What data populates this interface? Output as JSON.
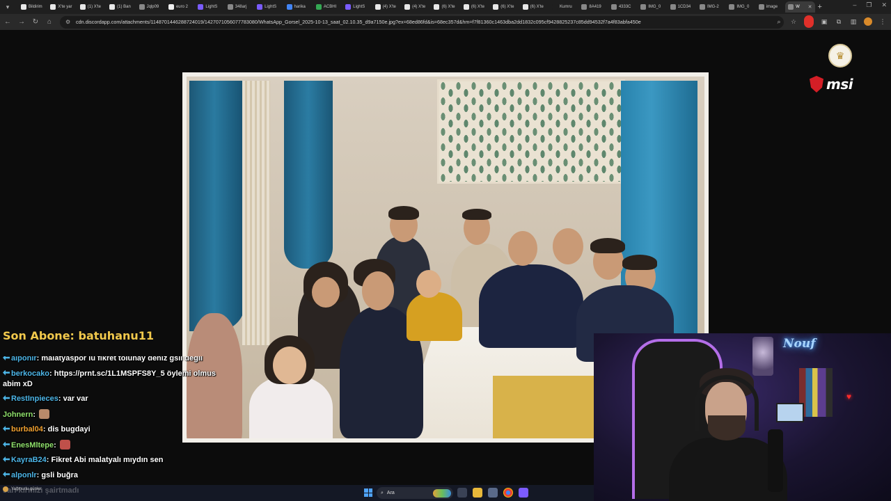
{
  "browser": {
    "tabs": [
      {
        "label": "Bildirim",
        "fav": "#e8e8e8"
      },
      {
        "label": "X'te yar",
        "fav": "#e8e8e8"
      },
      {
        "label": "(1) X'te",
        "fav": "#e8e8e8"
      },
      {
        "label": "(1) Ban",
        "fav": "#e8e8e8"
      },
      {
        "label": "Jqlp09",
        "fav": "#888888"
      },
      {
        "label": "euro 2",
        "fav": "#f0f0f0"
      },
      {
        "label": "LightS",
        "fav": "#7a5cff"
      },
      {
        "label": "348arj",
        "fav": "#888888"
      },
      {
        "label": "LightS",
        "fav": "#7a5cff"
      },
      {
        "label": "harika",
        "fav": "#4285f4"
      },
      {
        "label": "ACBHI",
        "fav": "#34a853"
      },
      {
        "label": "LightS",
        "fav": "#7a5cff"
      },
      {
        "label": "(4) X'te",
        "fav": "#e8e8e8"
      },
      {
        "label": "(4) X'te",
        "fav": "#e8e8e8"
      },
      {
        "label": "(6) X'te",
        "fav": "#e8e8e8"
      },
      {
        "label": "(6) X'te",
        "fav": "#e8e8e8"
      },
      {
        "label": "(6) X'te",
        "fav": "#e8e8e8"
      },
      {
        "label": "(6) X'te",
        "fav": "#e8e8e8"
      },
      {
        "label": "Kumru",
        "fav": "#1f1f1f"
      },
      {
        "label": "8A419",
        "fav": "#888888"
      },
      {
        "label": "4333C",
        "fav": "#888888"
      },
      {
        "label": "IMG_0",
        "fav": "#888888"
      },
      {
        "label": "1CD34",
        "fav": "#888888"
      },
      {
        "label": "IMG-2",
        "fav": "#888888"
      },
      {
        "label": "IMG_0",
        "fav": "#888888"
      },
      {
        "label": "image",
        "fav": "#888888"
      },
      {
        "label": "W",
        "fav": "#888888",
        "active": true
      }
    ],
    "url": "cdn.discordapp.com/attachments/1148701446288724019/1427071056077783080/WhatsApp_Gorsel_2025-10-13_saat_02.10.35_d9a7150e.jpg?ex=68ed86fd&is=68ec357d&hm=f7f81360c1463dba2dd1832c095cf9428825237c85dd94532f7a4f83abfa450e",
    "icons": {
      "back": "arrow-left-icon",
      "forward": "arrow-right-icon",
      "reload": "reload-icon",
      "home": "home-icon",
      "zoom": "zoom-icon",
      "star": "star-icon",
      "extensions": "puzzle-icon",
      "profile": "profile-icon",
      "menu": "kebab-menu-icon"
    }
  },
  "overlay": {
    "last_subscriber": "Son Abone: batuhanu11",
    "brand": "msi"
  },
  "chat": [
    {
      "user": "alponlr",
      "color": "#4db6e8",
      "text": "malatyaspor lu fikret tolunay deniz gsli degil",
      "cut": true
    },
    {
      "user": "berkocako",
      "color": "#4db6e8",
      "text": "https://prnt.sc/1L1MSPFS8Y_5 öylemi olmus abim xD"
    },
    {
      "user": "RestInpieces",
      "color": "#4db6e8",
      "text": "var var"
    },
    {
      "user": "Johnern",
      "color": "#8fe06b",
      "text": "",
      "emote": "#b88a6a",
      "nobadge": true
    },
    {
      "user": "burbal04",
      "color": "#f0a030",
      "text": "dis bugdayi"
    },
    {
      "user": "EnesMltepe",
      "color": "#8fe06b",
      "text": "",
      "emote": "#c0504a"
    },
    {
      "user": "KayraB24",
      "color": "#4db6e8",
      "text": "Fikret Abi malatyalı mıydın sen"
    },
    {
      "user": "alponlr",
      "color": "#4db6e8",
      "text": "gsli buğra"
    }
  ],
  "chat_ghost": "sarı kırmızı şairtmadı",
  "taskbar": {
    "weather": "Yağmurlu günler",
    "search_placeholder": "Ara"
  },
  "webcam": {
    "neon_sign": "Nouf"
  }
}
